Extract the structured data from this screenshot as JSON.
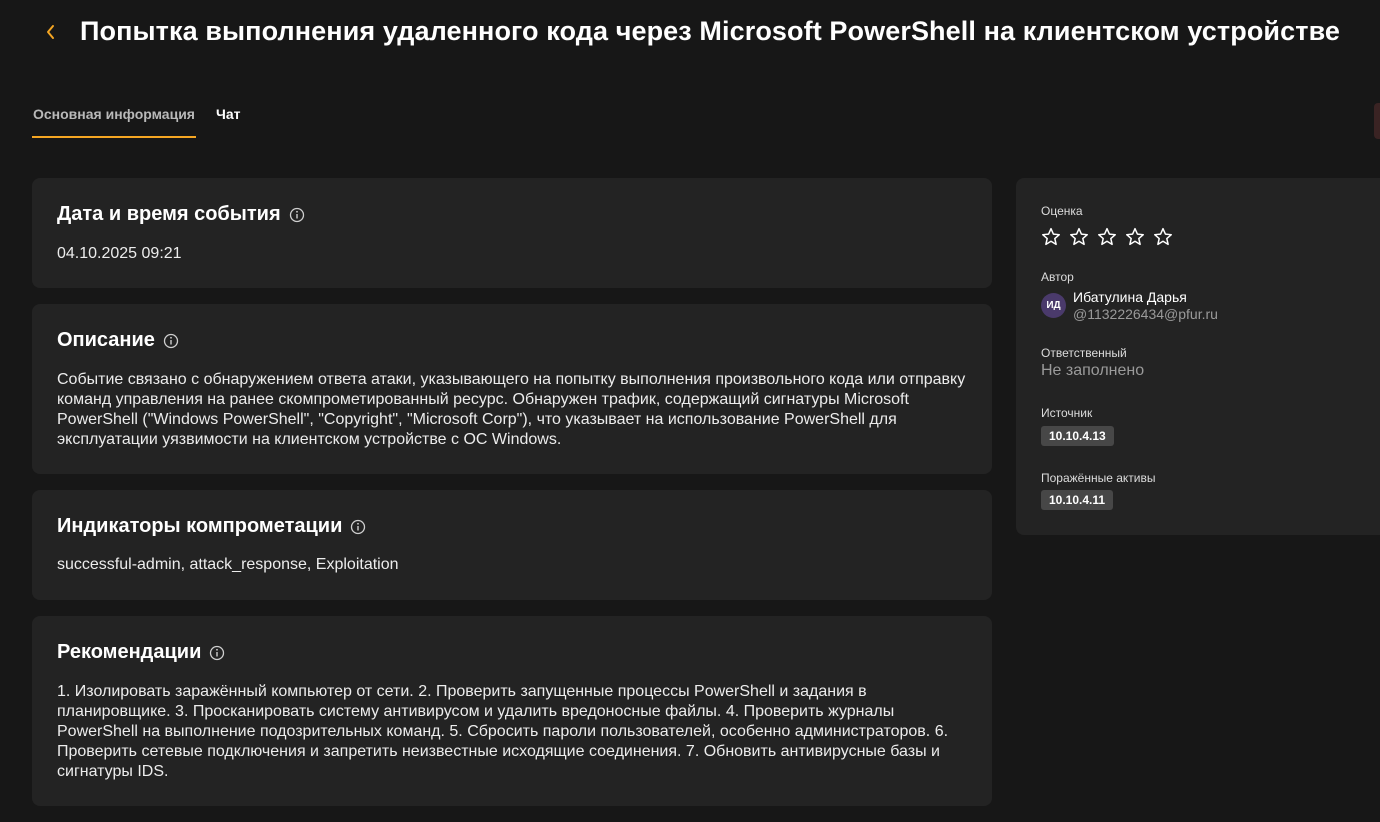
{
  "header": {
    "back_icon": "chevron-left-icon",
    "title": "Попытка выполнения удаленного кода через Microsoft PowerShell на клиентском устройстве"
  },
  "tabs": [
    {
      "label": "Основная информация",
      "active": true
    },
    {
      "label": "Чат",
      "active": false
    }
  ],
  "cards": {
    "datetime": {
      "title": "Дата и время события",
      "value": "04.10.2025 09:21"
    },
    "description": {
      "title": "Описание",
      "text": "Событие связано с обнаружением ответа атаки, указывающего на попытку выполнения произвольного кода или отправку команд управления на ранее скомпрометированный ресурс. Обнаружен трафик, содержащий сигнатуры Microsoft PowerShell (\"Windows PowerShell\", \"Copyright\", \"Microsoft Corp\"), что указывает на использование PowerShell для эксплуатации уязвимости на клиентском устройстве с ОС Windows."
    },
    "indicators": {
      "title": "Индикаторы компрометации",
      "text": "successful-admin, attack_response, Exploitation"
    },
    "recommendations": {
      "title": "Рекомендации",
      "text": "1. Изолировать заражённый компьютер от сети. 2. Проверить запущенные процессы PowerShell и задания в планировщике. 3. Просканировать систему антивирусом и удалить вредоносные файлы. 4. Проверить журналы PowerShell на выполнение подозрительных команд. 5. Сбросить пароли пользователей, особенно администраторов. 6. Проверить сетевые подключения и запретить неизвестные исходящие соединения. 7. Обновить антивирусные базы и сигнатуры IDS."
    }
  },
  "sidebar": {
    "rating": {
      "label": "Оценка",
      "value": 0,
      "max": 5,
      "icon": "star-outline-icon"
    },
    "author": {
      "label": "Автор",
      "initials": "ИД",
      "name": "Ибатулина Дарья",
      "handle": "@1132226434@pfur.ru"
    },
    "responsible": {
      "label": "Ответственный",
      "value": "Не заполнено"
    },
    "source": {
      "label": "Источник",
      "value": "10.10.4.13"
    },
    "assets": {
      "label": "Поражённые активы",
      "value": "10.10.4.11"
    }
  },
  "colors": {
    "background": "#171717",
    "card": "#232323",
    "accent": "#f5a623",
    "tag": "#474747",
    "muted": "#9a9a9a"
  }
}
